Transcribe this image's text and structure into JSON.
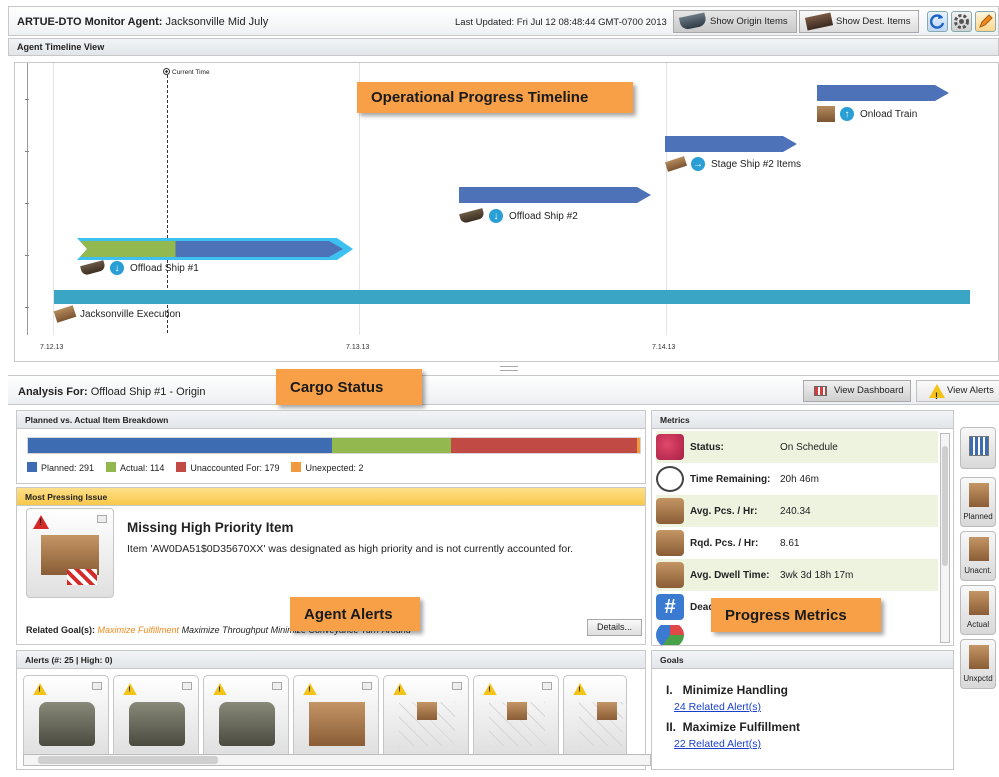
{
  "app": {
    "title_label": "ARTUE-DTO Monitor Agent:",
    "title_value": "Jacksonville Mid July",
    "last_updated": "Last Updated: Fri Jul 12 08:48:44 GMT-0700 2013",
    "buttons": {
      "show_origin": "Show Origin Items",
      "show_dest": "Show Dest. Items"
    }
  },
  "timeline": {
    "header": "Agent Timeline View",
    "current_time_label": "Current Time",
    "x_labels": [
      "7.12.13",
      "7.13.13",
      "7.14.13"
    ],
    "tasks": [
      {
        "label": "Jacksonville Execution"
      },
      {
        "label": "Offload Ship #1"
      },
      {
        "label": "Offload Ship #2"
      },
      {
        "label": "Stage Ship #2 Items"
      },
      {
        "label": "Onload Train"
      }
    ],
    "callout": "Operational Progress Timeline"
  },
  "analysis": {
    "label": "Analysis For:",
    "value": "Offload Ship #1  -  Origin",
    "callout": "Cargo Status",
    "view_dashboard": "View Dashboard",
    "view_alerts": "View Alerts"
  },
  "breakdown": {
    "header": "Planned vs. Actual Item Breakdown",
    "segments": [
      {
        "name": "Planned",
        "value": 291,
        "color": "#3d6cb3"
      },
      {
        "name": "Actual",
        "value": 114,
        "color": "#93b84f"
      },
      {
        "name": "Unaccounted For",
        "value": 179,
        "color": "#c24a44"
      },
      {
        "name": "Unexpected",
        "value": 2,
        "color": "#f0993e"
      }
    ],
    "legend_text": [
      "Planned: 291",
      "Actual: 114",
      "Unaccounted For: 179",
      "Unexpected: 2"
    ]
  },
  "issue": {
    "header": "Most Pressing Issue",
    "title": "Missing High Priority Item",
    "text": "Item 'AW0DA51$0D35670XX' was designated as high priority and is not currently accounted for.",
    "related_label": "Related Goal(s):",
    "goal1": "Maximize Fulfillment",
    "goal2": "Maximize Throughput",
    "goal3": "Minimize Conveyance Turn-Around",
    "details": "Details...",
    "callout": "Agent Alerts"
  },
  "alerts": {
    "header": "Alerts (#: 25 | High: 0)",
    "cards": [
      "humvee",
      "humvee",
      "humvee",
      "boxes",
      "crate-grid",
      "crate-grid",
      "crate-grid"
    ]
  },
  "metrics": {
    "header": "Metrics",
    "rows": [
      {
        "label": "Status:",
        "value": "On Schedule",
        "icon": "heart-check-icon"
      },
      {
        "label": "Time Remaining:",
        "value": "20h 46m",
        "icon": "clock-icon"
      },
      {
        "label": "Avg. Pcs. / Hr:",
        "value": "240.34",
        "icon": "percent-clock-icon"
      },
      {
        "label": "Rqd. Pcs. / Hr:",
        "value": "8.61",
        "icon": "percent-flag-icon"
      },
      {
        "label": "Avg. Dwell Time:",
        "value": "3wk 3d 18h 17m",
        "icon": "crate-clock-icon"
      },
      {
        "label": "Dead",
        "value": "",
        "icon": "hash-icon"
      }
    ],
    "callout": "Progress Metrics"
  },
  "goals": {
    "header": "Goals",
    "items": [
      {
        "title": "I.   Minimize Handling",
        "link": "24 Related Alert(s)"
      },
      {
        "title": "II.  Maximize Fulfillment",
        "link": "22 Related Alert(s)"
      }
    ]
  },
  "side_buttons": [
    "",
    "Planned",
    "Unacnt.",
    "Actual",
    "Unxpctd"
  ]
}
